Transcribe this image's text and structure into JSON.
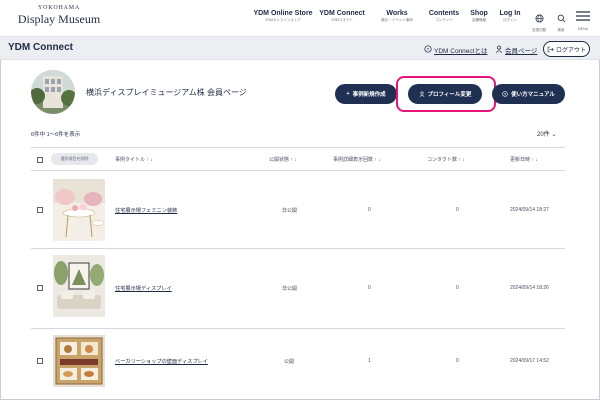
{
  "header": {
    "logo_small": "YOKOHAMA",
    "logo_main": "Display Museum",
    "nav": [
      {
        "label": "YDM Online Store",
        "sub": "YDMオンラインストア"
      },
      {
        "label": "YDM Connect",
        "sub": "YDMコネクト"
      },
      {
        "label": "Works",
        "sub": "展示・イベント事例"
      },
      {
        "label": "Contents",
        "sub": "コンテンツ"
      },
      {
        "label": "Shop",
        "sub": "店舗情報"
      },
      {
        "label": "Log In",
        "sub": "ログイン"
      }
    ],
    "icons": [
      {
        "name": "globe-icon",
        "sub": "言語切替"
      },
      {
        "name": "search-icon",
        "sub": "検索"
      },
      {
        "name": "menu-icon",
        "sub": "MENU"
      }
    ]
  },
  "subbar": {
    "title": "YDM Connect",
    "about_link": "YDM Connectとは",
    "member_link": "会員ページ",
    "logout_label": "ログアウト"
  },
  "profile": {
    "company": "横浜ディスプレイミュージアム株 会員ページ",
    "new_case_label": "事例新規作成",
    "edit_profile_label": "プロフィール変更",
    "manual_label": "使い方マニュアル"
  },
  "list": {
    "count_text": "6件中 1～6件を表示",
    "per_page": "20件",
    "bulk_delete_label": "選択項目を削除",
    "columns": [
      "事例タイトル",
      "公開状態",
      "事例詳細表示回数",
      "コンタクト数",
      "更新日時"
    ],
    "rows": [
      {
        "title": "住宅展示場フェミニン装飾",
        "status": "非公開",
        "views": "0",
        "contacts": "0",
        "updated": "2024/09/14 18:27"
      },
      {
        "title": "住宅展示場ディスプレイ",
        "status": "非公開",
        "views": "0",
        "contacts": "0",
        "updated": "2024/09/14 18:26"
      },
      {
        "title": "ベーカリーショップの壁面ディスプレイ",
        "status": "公開",
        "views": "1",
        "contacts": "0",
        "updated": "2024/09/17 14:52"
      }
    ]
  },
  "colors": {
    "navy": "#1f3052",
    "highlight": "#e5157a",
    "subbar_bg": "#eceef2"
  }
}
